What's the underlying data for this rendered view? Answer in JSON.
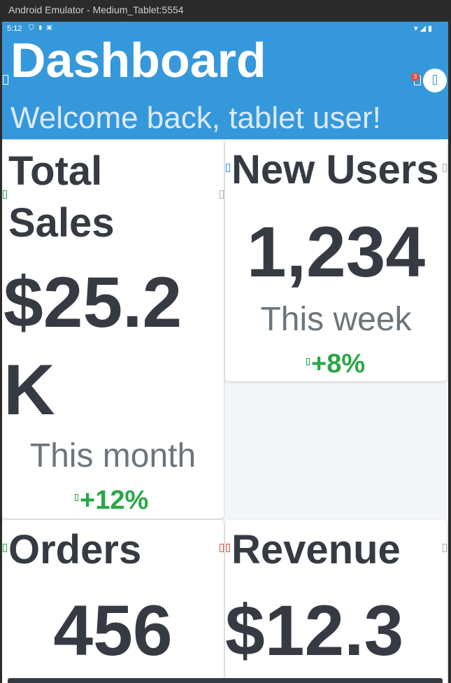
{
  "window": {
    "title": "Android Emulator - Medium_Tablet:5554"
  },
  "status_bar": {
    "time": "5:12"
  },
  "header": {
    "title": "Dashboard",
    "subtitle": "Welcome back, tablet user!",
    "notification_count": "3"
  },
  "cards": {
    "total_sales": {
      "title": "Total Sales",
      "value": "$25.2K",
      "period": "This month",
      "change": "+12%"
    },
    "new_users": {
      "title": "New Users",
      "value": "1,234",
      "period": "This week",
      "change": "+8%"
    },
    "orders": {
      "title": "Orders",
      "value": "456"
    },
    "revenue": {
      "title": "Revenue",
      "value": "$12.3"
    }
  },
  "colors": {
    "appbar": "#3598db",
    "positive": "#28a745",
    "badge": "#e74c3c",
    "text_dark": "#363b43",
    "text_muted": "#6c757d"
  }
}
